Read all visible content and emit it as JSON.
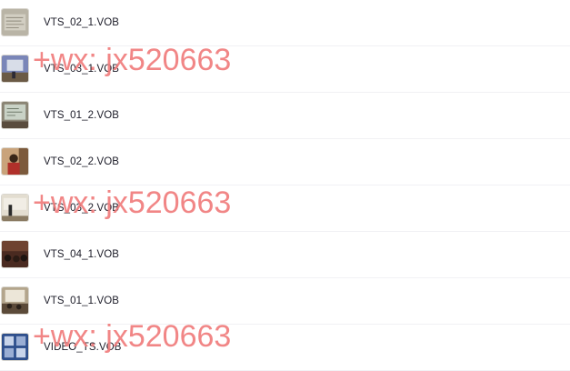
{
  "files": [
    {
      "name": "VTS_02_1.VOB",
      "thumb": "doc-scan"
    },
    {
      "name": "VTS_03_1.VOB",
      "thumb": "screen-room"
    },
    {
      "name": "VTS_01_2.VOB",
      "thumb": "projector-slide"
    },
    {
      "name": "VTS_02_2.VOB",
      "thumb": "speaker-red"
    },
    {
      "name": "VTS_03_2.VOB",
      "thumb": "stage-speaker"
    },
    {
      "name": "VTS_04_1.VOB",
      "thumb": "audience-dark"
    },
    {
      "name": "VTS_01_1.VOB",
      "thumb": "lecture-hall"
    },
    {
      "name": "VIDEO_TS.VOB",
      "thumb": "menu-grid"
    }
  ],
  "watermark": {
    "text": "+wx: jx520663",
    "color": "#f07c7c"
  }
}
